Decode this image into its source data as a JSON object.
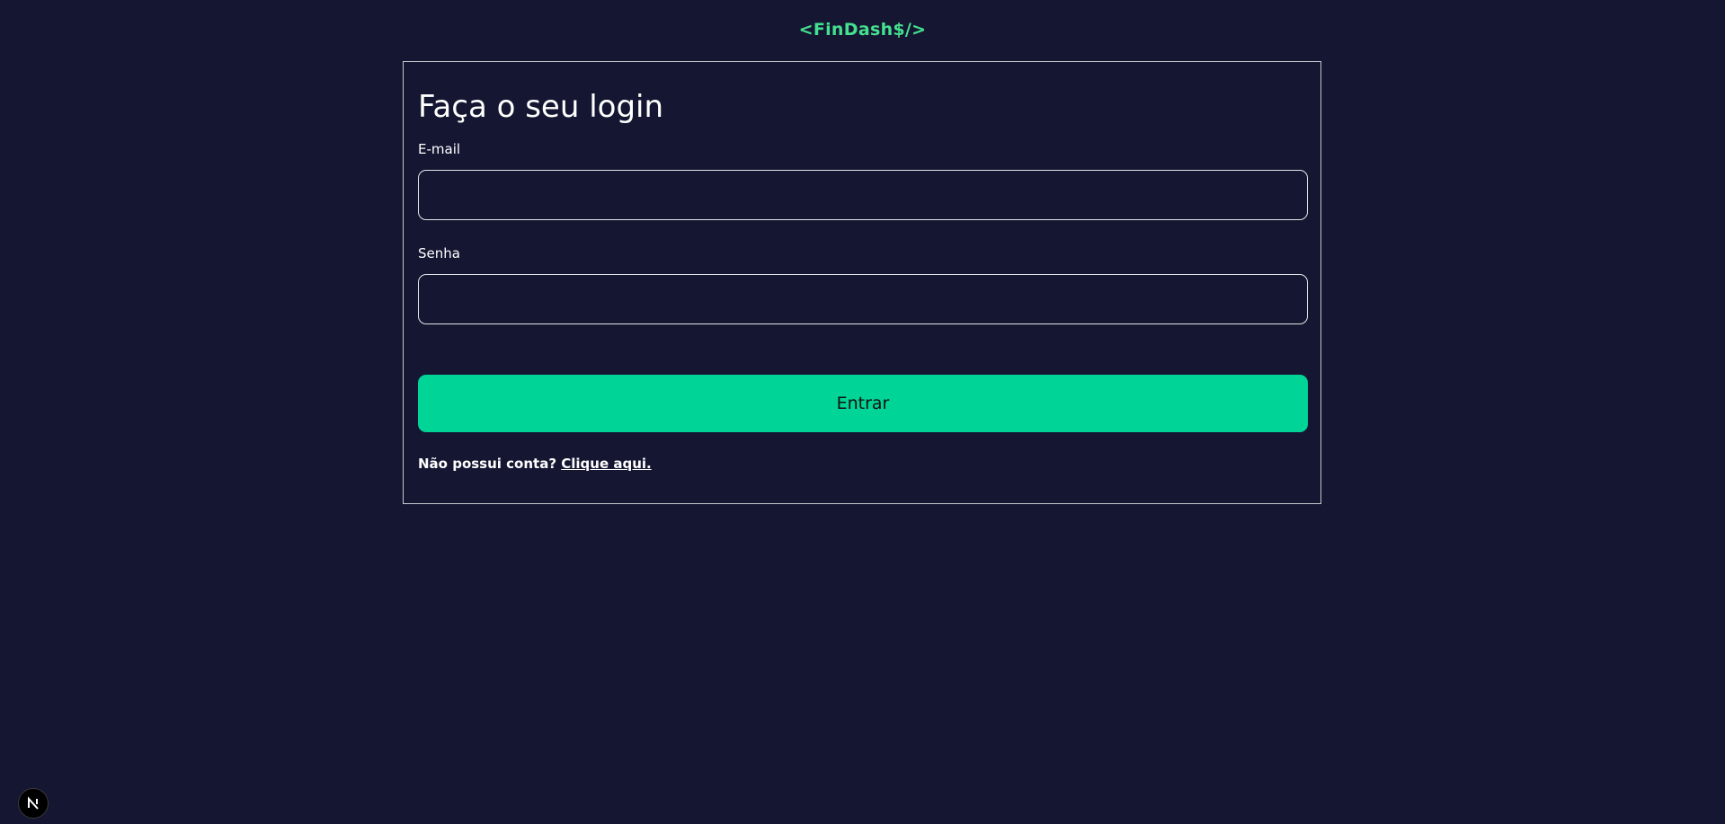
{
  "header": {
    "logo": "<FinDash$/>"
  },
  "login": {
    "title": "Faça o seu login",
    "email_label": "E-mail",
    "email_value": "",
    "password_label": "Senha",
    "password_value": "",
    "submit_label": "Entrar",
    "signup_prompt": "Não possui conta?",
    "signup_link": "Clique aqui."
  },
  "colors": {
    "background": "#141632",
    "logo": "#45e08f",
    "button": "#00d496",
    "text": "#ffffff"
  },
  "icons": {
    "badge": "nextjs-icon"
  }
}
